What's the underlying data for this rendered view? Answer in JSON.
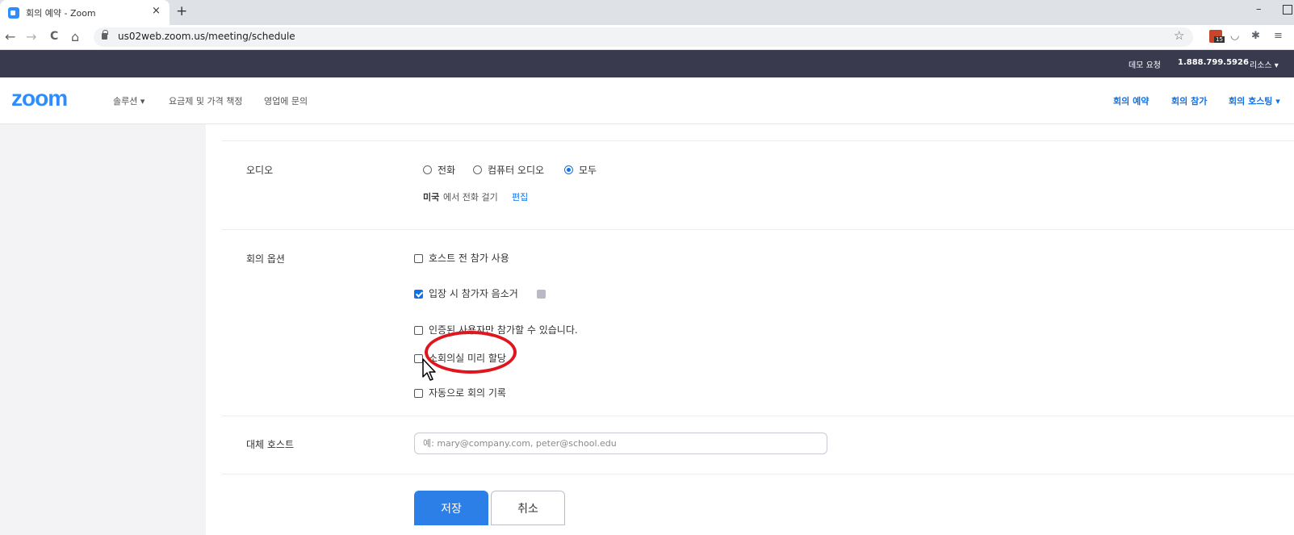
{
  "browser": {
    "tab_title": "회의 예약 - Zoom",
    "tab_close": "×",
    "new_tab": "+",
    "minimize": "–",
    "url": "us02web.zoom.us/meeting/schedule",
    "back": "←",
    "forward": "→",
    "reload": "C",
    "home": "⌂",
    "star": "☆",
    "ext_badge_count": "15",
    "ext_pocket": "◡",
    "ext_puzzle": "✱",
    "ext_menu": "≡"
  },
  "topbar": {
    "demo": "데모 요청",
    "phone": "1.888.799.5926",
    "resources": "리소스 ▾"
  },
  "nav": {
    "logo": "zoom",
    "solutions": "솔루션 ▾",
    "pricing": "요금제 및 가격 책정",
    "sales": "영업에 문의",
    "schedule": "회의 예약",
    "join": "회의 참가",
    "host": "회의 호스팅 ▾"
  },
  "audio": {
    "label": "오디오",
    "options": [
      {
        "label": "전화",
        "checked": false
      },
      {
        "label": "컴퓨터 오디오",
        "checked": false
      },
      {
        "label": "모두",
        "checked": true
      }
    ],
    "dial_country": "미국",
    "dial_text": "에서 전화 걸기",
    "edit": "편집"
  },
  "meeting_options": {
    "label": "회의 옵션",
    "items": [
      {
        "label": "호스트 전 참가 사용",
        "checked": false
      },
      {
        "label": "입장 시 참가자 음소거",
        "checked": true
      },
      {
        "label": "인증된 사용자만 참가할 수 있습니다.",
        "checked": false
      },
      {
        "label": "소회의실 미리 할당",
        "checked": false
      },
      {
        "label": "자동으로 회의 기록",
        "checked": false
      }
    ]
  },
  "alt_host": {
    "label": "대체 호스트",
    "placeholder": "예: mary@company.com, peter@school.edu"
  },
  "actions": {
    "save": "저장",
    "cancel": "취소"
  },
  "colors": {
    "accent": "#0e72ed",
    "zoom_blue": "#2d8cff",
    "annotation": "#e0161e"
  }
}
